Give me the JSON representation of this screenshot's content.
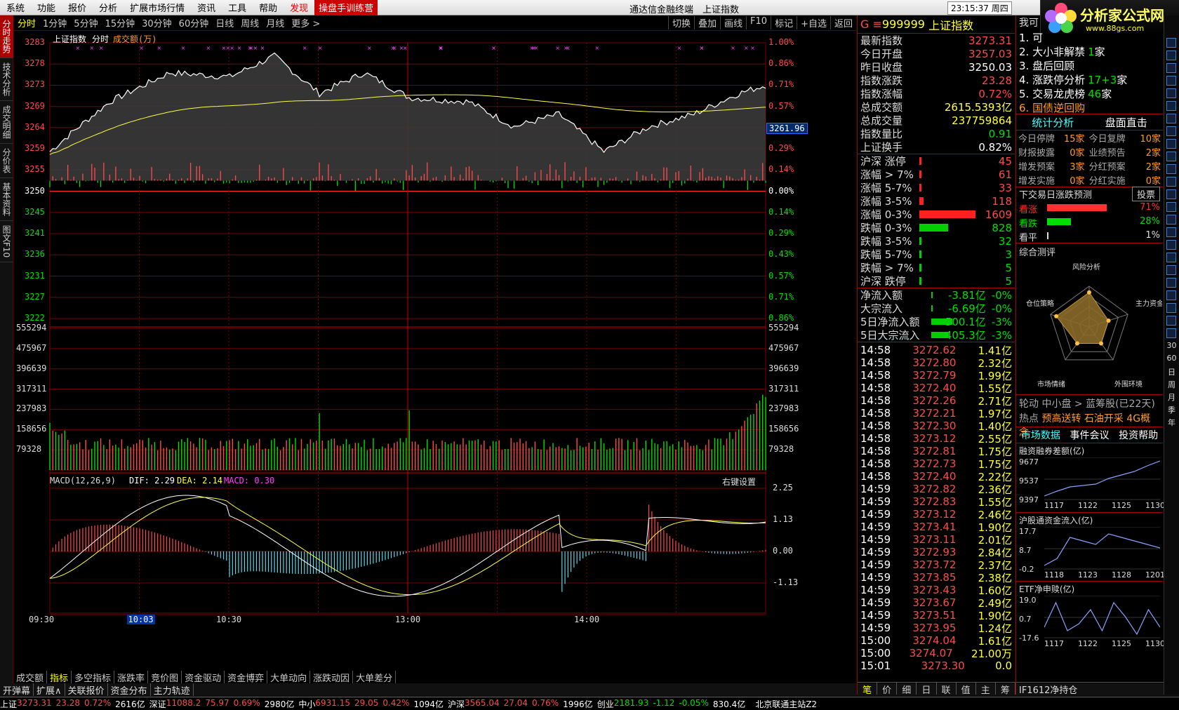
{
  "menu": {
    "items": [
      "系统",
      "功能",
      "报价",
      "分析",
      "扩展市场行情",
      "资讯",
      "工具",
      "帮助"
    ],
    "discover": "发现",
    "training": "操盘手训练营",
    "title": "通达信金融终端　上证指数",
    "clock": "23:15:37 周四",
    "find": "行"
  },
  "logo": {
    "name": "分析家公式网",
    "url": "www.88gs.com"
  },
  "left_tabs": [
    "分时走势",
    "技术分析",
    "成交明细",
    "分价表",
    "基本资料",
    "图文F10"
  ],
  "toolbar": {
    "periods": [
      "分时",
      "1分钟",
      "5分钟",
      "15分钟",
      "30分钟",
      "60分钟",
      "日线",
      "周线",
      "月线",
      "更多 >"
    ],
    "actions": [
      "切换",
      "叠加",
      "画线",
      "F10",
      "标记",
      "+自选",
      "返回"
    ]
  },
  "chart": {
    "header": {
      "name": "上证指数",
      "mode": "分时",
      "sub": "成交额(万)"
    },
    "price_ticks": [
      "3283",
      "3278",
      "3273",
      "3269",
      "3264",
      "3259",
      "3255",
      "3250",
      "3245",
      "3241",
      "3236",
      "3231",
      "3227",
      "3222"
    ],
    "pct_ticks": [
      "1.00%",
      "0.86%",
      "0.71%",
      "0.57%",
      "0.43%",
      "0.29%",
      "0.14%",
      "0.00%",
      "0.14%",
      "0.29%",
      "0.43%",
      "0.57%",
      "0.71%",
      "0.86%"
    ],
    "current_label": "3261.96",
    "vol_ticks": [
      "555294",
      "475967",
      "396639",
      "317311",
      "237983",
      "158656",
      "79328"
    ],
    "macd": {
      "title": "MACD(12,26,9)",
      "dif": "DIF: 2.29",
      "dea": "DEA: 2.14",
      "macd": "MACD: 0.30",
      "setting": "右键设置",
      "ticks": [
        "2.25",
        "1.13",
        "0.00",
        "-1.13"
      ]
    },
    "time_ticks": [
      "09:30",
      "10:03",
      "10:30",
      "13:00",
      "14:00"
    ]
  },
  "bottom_tabs": [
    "成交额",
    "指标",
    "多空指标",
    "涨跌率",
    "竞价图",
    "资金驱动",
    "资金博弈",
    "大单动向",
    "涨跌动因",
    "大单差分"
  ],
  "bottom_tabs2": [
    "开弹幕",
    "扩展∧",
    "关联报价",
    "资金分布",
    "主力轨迹"
  ],
  "quote": {
    "code": "999999",
    "name": "上证指数",
    "rows": [
      [
        "最新指数",
        "3273.31",
        "up"
      ],
      [
        "今日开盘",
        "3257.03",
        "up"
      ],
      [
        "昨日收盘",
        "3250.03",
        "wh"
      ],
      [
        "指数涨跌",
        "23.28",
        "up"
      ],
      [
        "指数涨幅",
        "0.72%",
        "up"
      ],
      [
        "总成交额",
        "2615.5393亿",
        "yl"
      ],
      [
        "总成交量",
        "237759864",
        "yl"
      ],
      [
        "指数量比",
        "0.91",
        "dn"
      ],
      [
        "上证换手",
        "0.82%",
        "wh"
      ]
    ],
    "dist": [
      [
        "沪深 涨停",
        "45",
        "up",
        4
      ],
      [
        "涨幅 > 7%",
        "61",
        "up",
        4
      ],
      [
        "涨幅 5-7%",
        "33",
        "up",
        3
      ],
      [
        "涨幅 3-5%",
        "118",
        "up",
        8
      ],
      [
        "涨幅 0-3%",
        "1609",
        "up",
        100
      ],
      [
        "跌幅 0-3%",
        "828",
        "dn",
        51
      ],
      [
        "跌幅 3-5%",
        "32",
        "dn",
        2
      ],
      [
        "跌幅 5-7%",
        "3",
        "dn",
        1
      ],
      [
        "跌幅 > 7%",
        "5",
        "dn",
        1
      ],
      [
        "沪深 跌停",
        "5",
        "dn",
        1
      ]
    ],
    "flow": [
      [
        "净流入额",
        "-3.81亿",
        "-0%",
        2
      ],
      [
        "大宗流入",
        "-6.69亿",
        "-0%",
        2
      ],
      [
        "5日净流入额",
        "-500.1亿",
        "-3%",
        30
      ],
      [
        "5日大宗流入",
        "-405.3亿",
        "-3%",
        25
      ]
    ],
    "ticks": [
      [
        "14:58",
        "3272.62",
        "1.41亿"
      ],
      [
        "14:58",
        "3272.80",
        "2.32亿"
      ],
      [
        "14:58",
        "3272.79",
        "1.99亿"
      ],
      [
        "14:58",
        "3272.40",
        "1.55亿"
      ],
      [
        "14:58",
        "3272.26",
        "2.71亿"
      ],
      [
        "14:58",
        "3272.21",
        "1.97亿"
      ],
      [
        "14:58",
        "3272.30",
        "1.40亿"
      ],
      [
        "14:58",
        "3273.12",
        "2.55亿"
      ],
      [
        "14:58",
        "3272.81",
        "1.75亿"
      ],
      [
        "14:58",
        "3272.73",
        "1.75亿"
      ],
      [
        "14:58",
        "3272.40",
        "2.22亿"
      ],
      [
        "14:59",
        "3272.82",
        "2.36亿"
      ],
      [
        "14:59",
        "3272.83",
        "1.55亿"
      ],
      [
        "14:59",
        "3273.12",
        "2.46亿"
      ],
      [
        "14:59",
        "3273.41",
        "1.90亿"
      ],
      [
        "14:59",
        "3273.11",
        "2.01亿"
      ],
      [
        "14:59",
        "3272.93",
        "2.84亿"
      ],
      [
        "14:59",
        "3273.72",
        "2.37亿"
      ],
      [
        "14:59",
        "3273.85",
        "2.38亿"
      ],
      [
        "14:59",
        "3273.43",
        "1.60亿"
      ],
      [
        "14:59",
        "3273.67",
        "2.49亿"
      ],
      [
        "14:59",
        "3273.51",
        "1.90亿"
      ],
      [
        "14:59",
        "3273.95",
        "1.24亿"
      ],
      [
        "15:00",
        "3274.04",
        "1.61亿"
      ],
      [
        "15:00",
        "3274.07",
        "21.00万"
      ],
      [
        "15:01",
        "3273.30",
        "0.0"
      ]
    ],
    "tabs": [
      "笔",
      "价",
      "细",
      "日",
      "联",
      "值",
      "主",
      "筹"
    ]
  },
  "side": {
    "find": "我可",
    "list": [
      [
        "1. 可",
        "",
        ""
      ],
      [
        "2. 大小非解禁",
        "1",
        "家"
      ],
      [
        "3. 盘后回顾",
        "",
        ""
      ],
      [
        "4. 涨跌停分析",
        "17+3",
        "家"
      ],
      [
        "5. 交易龙虎榜",
        "46",
        "家"
      ],
      [
        "6. 国债逆回购",
        "",
        ""
      ]
    ],
    "stat_tabs": [
      "统计分析",
      "盘面直击"
    ],
    "stats": [
      [
        "今日停牌",
        "15家",
        "今日复牌",
        "10家"
      ],
      [
        "财报披露",
        "0家",
        "业绩预告",
        "2家"
      ],
      [
        "增发预案",
        "3家",
        "分红预案",
        "2家"
      ],
      [
        "增发实施",
        "0家",
        "分红实施",
        "0家"
      ]
    ],
    "predict": {
      "title": "下交易日涨跌预测",
      "vote": "投票",
      "rows": [
        [
          "看涨",
          "71%",
          71
        ],
        [
          "看跌",
          "28%",
          28
        ],
        [
          "看平",
          "1%",
          1
        ]
      ]
    },
    "radar": {
      "title": "综合测评",
      "labels": [
        "风险分析",
        "主力资金",
        "外围环境",
        "市场情绪",
        "仓位策略"
      ]
    },
    "rotation": "轮动 中小盘 > 蓝筹股(已22天)",
    "hot": [
      "热点",
      "预高送转",
      "石油开采",
      "4G概念"
    ],
    "market_tabs": [
      "市场数据",
      "事件会议",
      "投资帮助"
    ],
    "mini1": {
      "title": "融资融券差额(亿)",
      "y": [
        "9677",
        "9537",
        "9397"
      ],
      "x": [
        "1117",
        "1122",
        "1125",
        "1130"
      ]
    },
    "mini2": {
      "title": "沪股通资金流入(亿)",
      "y": [
        "17.7",
        "8.7",
        "-0.2"
      ],
      "x": [
        "1118",
        "1123",
        "1128",
        "1201"
      ]
    },
    "mini3": {
      "title": "ETF净申赎(亿)",
      "y": [
        "19.0",
        "0.7",
        "-17.6"
      ],
      "x": [
        "1117",
        "1122",
        "1125",
        "1130"
      ]
    },
    "futures": "IF1612净持仓",
    "side_icons": [
      "30",
      "60",
      "日",
      "周",
      "月",
      "季",
      "年"
    ]
  },
  "status": {
    "items": [
      [
        "上证",
        "3273.31",
        "up"
      ],
      [
        "23.28",
        "",
        "up"
      ],
      [
        "0.72%",
        "",
        "up"
      ],
      [
        "2616亿",
        "",
        "wh"
      ],
      [
        "深证",
        "11088.2",
        "up"
      ],
      [
        "75.97",
        "",
        "up"
      ],
      [
        "0.69%",
        "",
        "up"
      ],
      [
        "2980亿",
        "",
        "wh"
      ],
      [
        "中小",
        "6931.15",
        "up"
      ],
      [
        "29.05",
        "",
        "up"
      ],
      [
        "0.42%",
        "",
        "up"
      ],
      [
        "1094亿",
        "",
        "wh"
      ],
      [
        "沪深",
        "3565.04",
        "up"
      ],
      [
        "27.04",
        "",
        "up"
      ],
      [
        "0.76%",
        "",
        "up"
      ],
      [
        "1996亿",
        "",
        "wh"
      ],
      [
        "创业",
        "2181.93",
        "dn"
      ],
      [
        "-1.12",
        "",
        "dn"
      ],
      [
        "-0.05%",
        "",
        "dn"
      ],
      [
        "830.4亿",
        "",
        "wh"
      ]
    ],
    "server": "北京联通主站Z2"
  },
  "palette": {
    "up": "#ff4b4b",
    "dn": "#00e000",
    "grid": "#7a0000",
    "price": "#ffffff",
    "avg": "#ffff40",
    "dif": "#ffffff",
    "dea": "#ffff40",
    "neg": "#58d8e8"
  }
}
